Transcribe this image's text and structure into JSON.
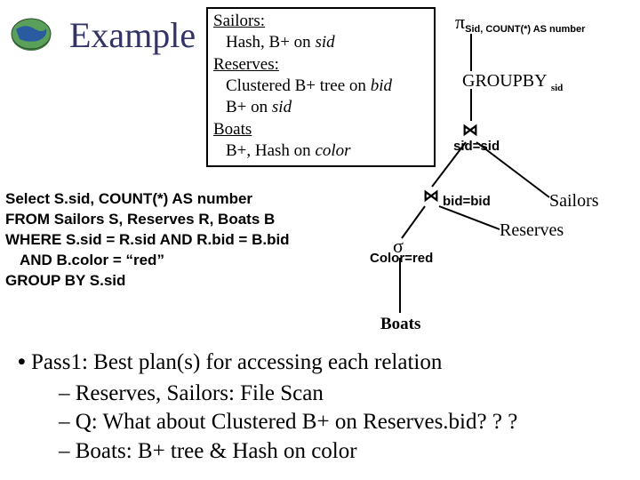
{
  "title": "Example",
  "schema": {
    "sailors_tbl": "Sailors:",
    "sailors_idx": "Hash, B+ on sid",
    "reserves_tbl": "Reserves:",
    "reserves_idx1": "Clustered B+ tree on bid",
    "reserves_idx2": "B+ on sid",
    "boats_tbl": "Boats",
    "boats_idx": "B+, Hash on color"
  },
  "sql": {
    "l1": "Select S.sid, COUNT(*) AS number",
    "l2": "FROM  Sailors S, Reserves R, Boats B",
    "l3": "WHERE  S.sid = R.sid AND R.bid = B.bid",
    "l4": "AND B.color = “red”",
    "l5": "GROUP BY S.sid"
  },
  "tree": {
    "pi_sym": "π",
    "pi_sub": "Sid, COUNT(*) AS number",
    "groupby": "GROUPBY",
    "groupby_sub": "sid",
    "join1_label": "sid=sid",
    "join2_label": "bid=bid",
    "sigma_sym": "σ",
    "sigma_label": "Color=red",
    "sailors": "Sailors",
    "reserves": "Reserves",
    "boats": "Boats"
  },
  "bullets": {
    "b1": "Pass1: Best plan(s) for accessing each relation",
    "b2a": "Reserves, Sailors: File Scan",
    "b2b": "Q: What about Clustered B+ on Reserves.bid? ? ?",
    "b2c": "Boats: B+ tree & Hash on  color"
  }
}
